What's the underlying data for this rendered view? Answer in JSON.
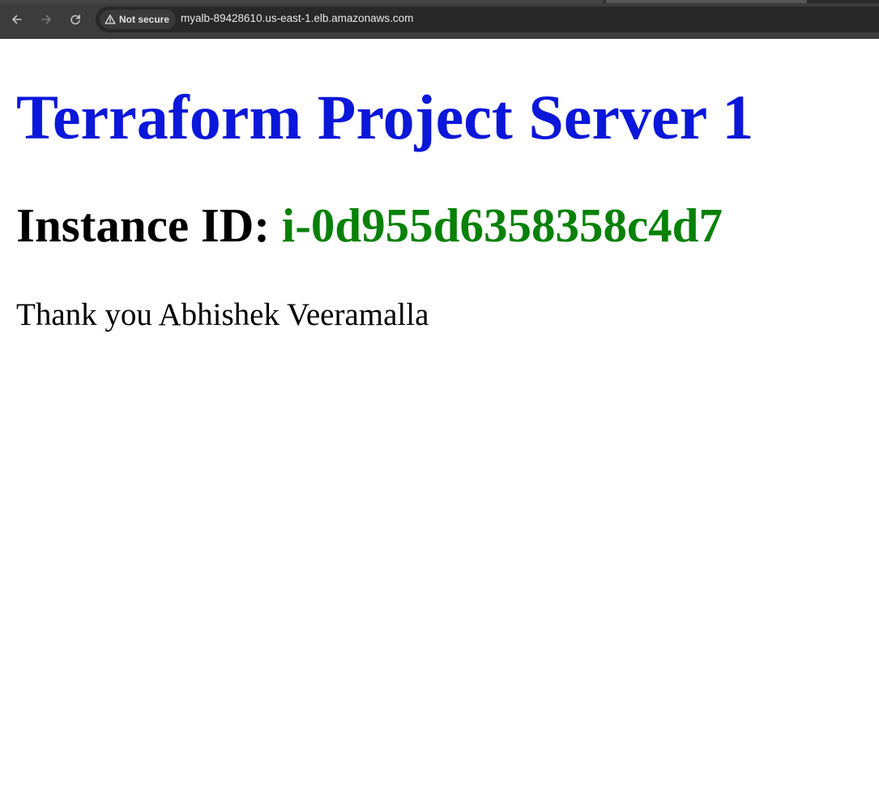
{
  "browser": {
    "security_label": "Not secure",
    "url": "myalb-89428610.us-east-1.elb.amazonaws.com",
    "icons": {
      "back": "arrow-left-icon",
      "forward": "arrow-right-icon",
      "reload": "reload-icon",
      "security": "warning-triangle-icon"
    }
  },
  "page": {
    "heading": "Terraform Project Server 1",
    "instance_label": "Instance ID:",
    "instance_id": "i-0d955d6358358c4d7",
    "message": "Thank you Abhishek Veeramalla"
  },
  "colors": {
    "heading": "#0b17d9",
    "instance_id": "#078107",
    "toolbar": "#3c3c3c",
    "omnibox": "#282828"
  }
}
